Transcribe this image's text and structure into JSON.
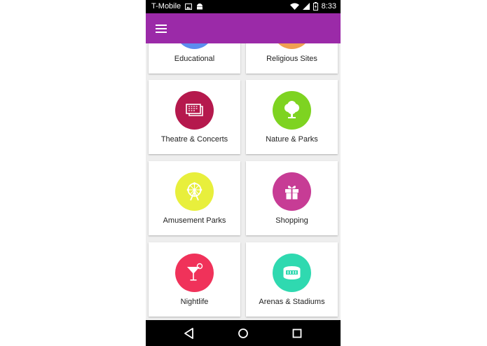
{
  "status_bar": {
    "carrier": "T-Mobile",
    "time": "8:33"
  },
  "app_bar": {
    "menu_icon": "hamburger-menu-icon",
    "color": "#9b2aa8"
  },
  "categories": [
    {
      "label": "Educational",
      "color": "#5b8def",
      "icon": "book-icon"
    },
    {
      "label": "Religious Sites",
      "color": "#f0a050",
      "icon": "church-icon"
    },
    {
      "label": "Theatre & Concerts",
      "color": "#b5194d",
      "icon": "ticket-icon"
    },
    {
      "label": "Nature & Parks",
      "color": "#7ed321",
      "icon": "tree-icon"
    },
    {
      "label": "Amusement Parks",
      "color": "#e8ef3c",
      "icon": "ferris-wheel-icon"
    },
    {
      "label": "Shopping",
      "color": "#c73c95",
      "icon": "gift-icon"
    },
    {
      "label": "Nightlife",
      "color": "#f0325a",
      "icon": "cocktail-icon"
    },
    {
      "label": "Arenas & Stadiums",
      "color": "#2fd9b0",
      "icon": "stadium-icon"
    }
  ],
  "nav_bar": {
    "back_icon": "back-icon",
    "home_icon": "home-icon",
    "recents_icon": "recents-icon"
  }
}
